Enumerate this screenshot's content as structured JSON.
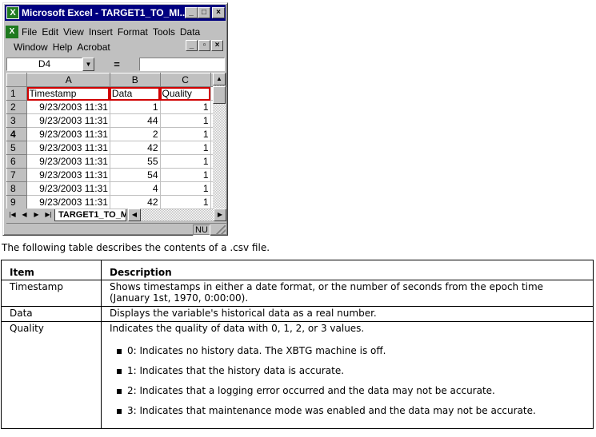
{
  "excel": {
    "title": "Microsoft Excel - TARGET1_TO_MI...",
    "menu_row1": [
      "File",
      "Edit",
      "View",
      "Insert",
      "Format",
      "Tools",
      "Data"
    ],
    "menu_row2": [
      "Window",
      "Help",
      "Acrobat"
    ],
    "name_box": "D4",
    "formula_eq": "=",
    "column_headers": [
      "A",
      "B",
      "C"
    ],
    "row_numbers": [
      "1",
      "2",
      "3",
      "4",
      "5",
      "6",
      "7",
      "8",
      "9"
    ],
    "header_row": [
      "Timestamp",
      "Data",
      "Quality"
    ],
    "rows": [
      [
        "9/23/2003 11:31",
        "1",
        "1"
      ],
      [
        "9/23/2003 11:31",
        "44",
        "1"
      ],
      [
        "9/23/2003 11:31",
        "2",
        "1"
      ],
      [
        "9/23/2003 11:31",
        "42",
        "1"
      ],
      [
        "9/23/2003 11:31",
        "55",
        "1"
      ],
      [
        "9/23/2003 11:31",
        "54",
        "1"
      ],
      [
        "9/23/2003 11:31",
        "4",
        "1"
      ],
      [
        "9/23/2003 11:31",
        "42",
        "1"
      ]
    ],
    "sheet_tab": "TARGET1_TO_M",
    "status": "NU"
  },
  "intro_text": "The following table describes the contents of a .csv file.",
  "table": {
    "headers": [
      "Item",
      "Description"
    ],
    "rows": [
      {
        "item": "Timestamp",
        "description": "Shows timestamps in either a date format, or the number of seconds from the epoch time (January 1st, 1970, 0:00:00)."
      },
      {
        "item": "Data",
        "description": "Displays the variable's historical data as a real number."
      },
      {
        "item": "Quality",
        "description": "Indicates the quality of data with 0, 1, 2, or 3 values."
      }
    ],
    "quality_bullets": [
      "0: Indicates no history data. The XBTG machine is off.",
      "1: Indicates that the history data is accurate.",
      "2: Indicates that a logging error occurred and the data may not be accurate.",
      "3: Indicates that maintenance mode was enabled and the data may not be accurate."
    ]
  }
}
